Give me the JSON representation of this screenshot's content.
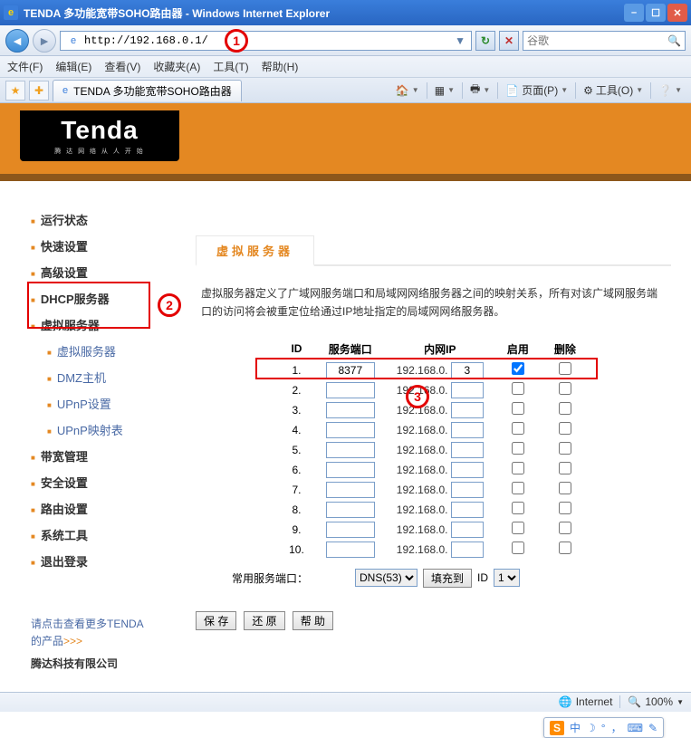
{
  "window": {
    "title": "TENDA 多功能宽带SOHO路由器 - Windows Internet Explorer"
  },
  "address_bar": {
    "url": "http://192.168.0.1/"
  },
  "search": {
    "placeholder": "谷歌"
  },
  "menus": {
    "file": "文件(F)",
    "edit": "编辑(E)",
    "view": "查看(V)",
    "favorites": "收藏夹(A)",
    "tools": "工具(T)",
    "help": "帮助(H)"
  },
  "browser_tab": {
    "label": "TENDA 多功能宽带SOHO路由器"
  },
  "ie_tools": {
    "page": "页面(P)",
    "tools": "工具(O)"
  },
  "brand": {
    "name": "Tenda",
    "sub": "腾 达 网 络 从 人 开 始"
  },
  "sidebar": {
    "items": [
      {
        "label": "运行状态"
      },
      {
        "label": "快速设置"
      },
      {
        "label": "高级设置"
      },
      {
        "label": "DHCP服务器"
      },
      {
        "label": "虚拟服务器"
      },
      {
        "label": "虚拟服务器",
        "sub": true
      },
      {
        "label": "DMZ主机",
        "sub": true
      },
      {
        "label": "UPnP设置",
        "sub": true
      },
      {
        "label": "UPnP映射表",
        "sub": true
      },
      {
        "label": "带宽管理"
      },
      {
        "label": "安全设置"
      },
      {
        "label": "路由设置"
      },
      {
        "label": "系统工具"
      },
      {
        "label": "退出登录"
      }
    ],
    "promo_l1": "请点击查看更多TENDA",
    "promo_l2": "的产品",
    "promo_arrow": ">>>",
    "promo_company": "腾达科技有限公司"
  },
  "page": {
    "tab_title": "虚拟服务器",
    "description": "虚拟服务器定义了广域网服务端口和局域网网络服务器之间的映射关系，所有对该广域网服务端口的访问将会被重定位给通过IP地址指定的局域网网络服务器。",
    "th_id": "ID",
    "th_port": "服务端口",
    "th_ip": "内网IP",
    "th_enable": "启用",
    "th_del": "删除",
    "lan_prefix": "192.168.0.",
    "rows": [
      {
        "id": "1.",
        "port": "8377",
        "ip": "3",
        "enable": true
      },
      {
        "id": "2.",
        "port": "",
        "ip": "",
        "enable": false
      },
      {
        "id": "3.",
        "port": "",
        "ip": "",
        "enable": false
      },
      {
        "id": "4.",
        "port": "",
        "ip": "",
        "enable": false
      },
      {
        "id": "5.",
        "port": "",
        "ip": "",
        "enable": false
      },
      {
        "id": "6.",
        "port": "",
        "ip": "",
        "enable": false
      },
      {
        "id": "7.",
        "port": "",
        "ip": "",
        "enable": false
      },
      {
        "id": "8.",
        "port": "",
        "ip": "",
        "enable": false
      },
      {
        "id": "9.",
        "port": "",
        "ip": "",
        "enable": false
      },
      {
        "id": "10.",
        "port": "",
        "ip": "",
        "enable": false
      }
    ],
    "common_port_label": "常用服务端口：",
    "common_port_value": "DNS(53)",
    "fill_to": "填充到",
    "fill_id_label": "ID",
    "fill_id_value": "1",
    "btn_save": "保 存",
    "btn_restore": "还 原",
    "btn_help": "帮 助"
  },
  "ime": {
    "mode": "中",
    "punct": "，",
    "shape": "°",
    "keyboard": "⌨",
    "tool": "✎"
  },
  "status": {
    "zone": "Internet",
    "zoom": "100%"
  },
  "annot": {
    "n1": "1",
    "n2": "2",
    "n3": "3"
  }
}
